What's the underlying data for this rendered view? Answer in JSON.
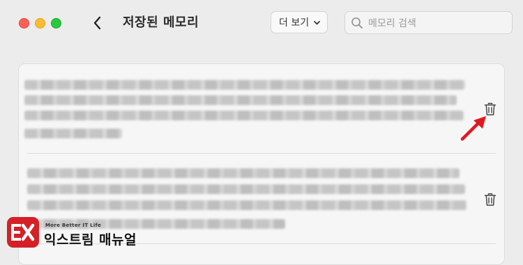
{
  "window": {
    "title": "저장된 메모리",
    "controls": [
      "close",
      "minimize",
      "maximize"
    ]
  },
  "toolbar": {
    "back_icon": "chevron-left-icon",
    "more_label": "더 보기",
    "more_icon": "chevron-down-icon",
    "search_icon": "magnifier-icon",
    "search_placeholder": "메모리 검색"
  },
  "memories": [
    {
      "text_state": "blurred",
      "action_icon": "trash-icon"
    },
    {
      "text_state": "blurred",
      "action_icon": "trash-icon"
    }
  ],
  "annotation": {
    "icon": "red-arrow-icon",
    "color": "#e0191f"
  },
  "watermark": {
    "logo": "EX",
    "tagline": "More Better IT Life",
    "name": "익스트림 매뉴얼",
    "brand_color": "#d42027"
  },
  "colors": {
    "traffic_close": "#fe5f57",
    "traffic_min": "#febc2e",
    "traffic_max": "#28c840"
  }
}
